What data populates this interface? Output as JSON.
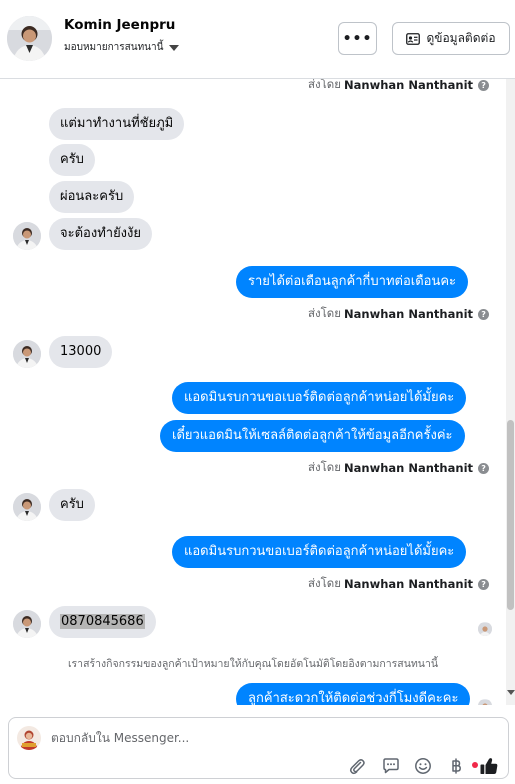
{
  "header": {
    "contact_name": "Komin Jeenpru",
    "assign_label": "มอบหมายการสนทนานี้",
    "more_label": "•••",
    "info_label": "ดูข้อมูลติดต่อ"
  },
  "sent_by_prefix": "ส่งโดย",
  "agent_name": "Nanwhan Nanthanit",
  "help_glyph": "?",
  "messages": {
    "in_1": "แต่มาทำงานที่ชัยภูมิ",
    "in_2": "ครับ",
    "in_3": "ผ่อนละครับ",
    "in_4": "จะต้องทำยังงัย",
    "out_1": "รายได้ต่อเดือนลูกค้ากี่บาทต่อเดือนคะ",
    "in_5": "13000",
    "out_2": "แอดมินรบกวนขอเบอร์ติดต่อลูกค้าหน่อยได้มั้ยคะ",
    "out_3": "เดี๋ยวแอดมินให้เซลล์ติดต่อลูกค้าให้ข้อมูลอีกครั้งค่ะ",
    "in_6": "ครับ",
    "out_4": "แอดมินรบกวนขอเบอร์ติดต่อลูกค้าหน่อยได้มั้ยคะ",
    "in_7": "0870845686",
    "system_note": "เราสร้างกิจกรรมของลูกค้าเป้าหมายให้กับคุณโดยอัตโนมัติโดยอิงตามการสนทนานี้",
    "out_5": "ลูกค้าสะดวกให้ติดต่อช่วงกี่โมงดีคะคะ"
  },
  "reply": {
    "placeholder": "ตอบกลับใน Messenger..."
  },
  "colors": {
    "outgoing_bubble": "#0084ff",
    "incoming_bubble": "#e4e6eb",
    "like_icon": "#1c1e21",
    "badge": "#f02849"
  }
}
